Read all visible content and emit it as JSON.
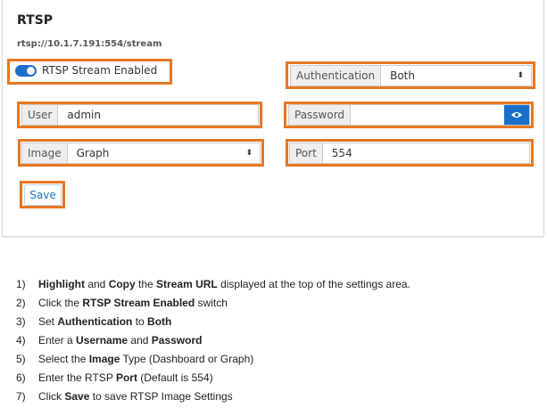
{
  "rtsp": {
    "title": "RTSP",
    "stream_url": "rtsp://10.1.7.191:554/stream",
    "enabled_label": "RTSP Stream Enabled",
    "enabled": true,
    "authentication": {
      "label": "Authentication",
      "value": "Both"
    },
    "user": {
      "label": "User",
      "value": "admin"
    },
    "password": {
      "label": "Password",
      "value": ""
    },
    "image": {
      "label": "Image",
      "value": "Graph"
    },
    "port": {
      "label": "Port",
      "value": "554"
    },
    "save_label": "Save"
  },
  "colors": {
    "highlight": "#e87722",
    "accent": "#1a6fc9"
  },
  "instructions": [
    {
      "n": "1)",
      "parts": [
        {
          "t": "Highlight",
          "b": true
        },
        {
          "t": " and ",
          "b": false
        },
        {
          "t": "Copy",
          "b": true
        },
        {
          "t": " the ",
          "b": false
        },
        {
          "t": "Stream URL",
          "b": true
        },
        {
          "t": " displayed at the top of the settings area.",
          "b": false
        }
      ]
    },
    {
      "n": "2)",
      "parts": [
        {
          "t": "Click the ",
          "b": false
        },
        {
          "t": "RTSP Stream Enabled",
          "b": true
        },
        {
          "t": " switch",
          "b": false
        }
      ]
    },
    {
      "n": "3)",
      "parts": [
        {
          "t": "Set ",
          "b": false
        },
        {
          "t": "Authentication",
          "b": true
        },
        {
          "t": " to ",
          "b": false
        },
        {
          "t": "Both",
          "b": true
        }
      ]
    },
    {
      "n": "4)",
      "parts": [
        {
          "t": "Enter a ",
          "b": false
        },
        {
          "t": "Username",
          "b": true
        },
        {
          "t": " and ",
          "b": false
        },
        {
          "t": "Password",
          "b": true
        }
      ]
    },
    {
      "n": "5)",
      "parts": [
        {
          "t": "Select the ",
          "b": false
        },
        {
          "t": "Image",
          "b": true
        },
        {
          "t": " Type (Dashboard or Graph)",
          "b": false
        }
      ]
    },
    {
      "n": "6)",
      "parts": [
        {
          "t": "Enter the RTSP ",
          "b": false
        },
        {
          "t": "Port",
          "b": true
        },
        {
          "t": " (Default is 554)",
          "b": false
        }
      ]
    },
    {
      "n": "7)",
      "parts": [
        {
          "t": "Click ",
          "b": false
        },
        {
          "t": "Save",
          "b": true
        },
        {
          "t": " to save RTSP Image Settings",
          "b": false
        }
      ]
    }
  ]
}
